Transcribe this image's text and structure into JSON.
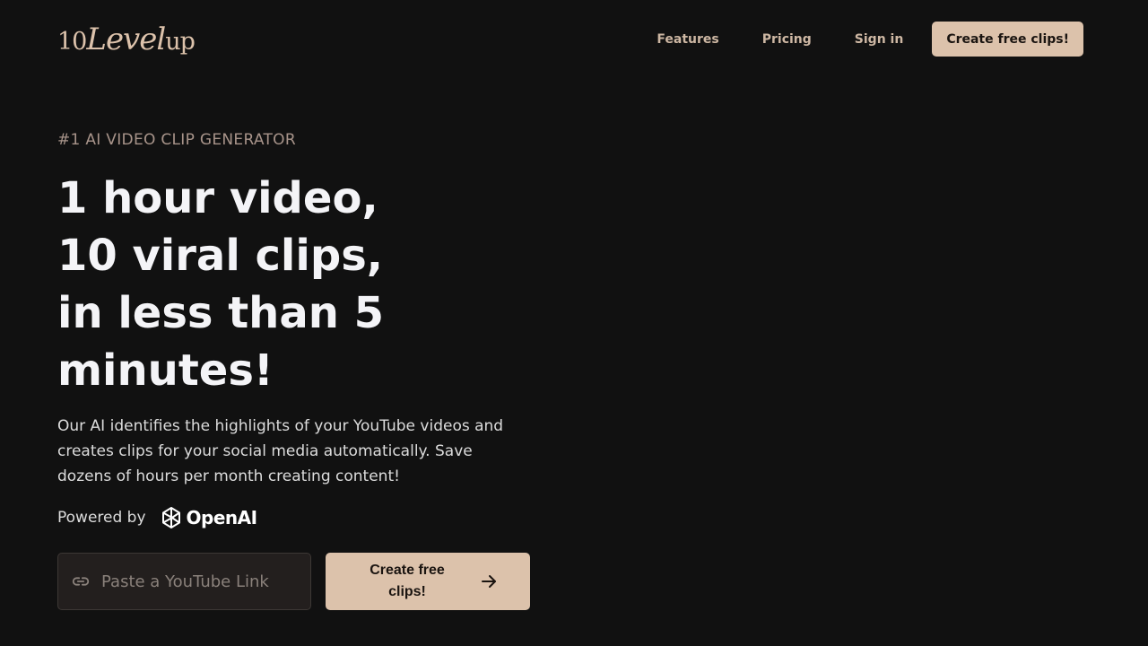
{
  "brand": {
    "logo_num": "10",
    "logo_level": "Level",
    "logo_up": "up"
  },
  "nav": {
    "items": [
      {
        "label": "Features"
      },
      {
        "label": "Pricing"
      },
      {
        "label": "Sign in"
      }
    ],
    "cta_label": "Create free clips!"
  },
  "hero": {
    "eyebrow": "#1 AI VIDEO CLIP GENERATOR",
    "headline_lines": [
      "1 hour video,",
      "10 viral clips,",
      "in less than 5",
      "minutes!"
    ],
    "description": "Our AI identifies the highlights of your YouTube videos and creates clips for your social media automatically. Save dozens of hours per month creating content!",
    "powered_by": "Powered by",
    "partner": "OpenAI"
  },
  "form": {
    "input_placeholder": "Paste a YouTube Link",
    "input_value": "",
    "submit_label": "Create free clips!",
    "link_icon": "link-icon",
    "arrow_icon": "arrow-right-icon"
  },
  "colors": {
    "background": "#111111",
    "accent": "#dcc2ab",
    "nav_text": "#cdb7a3",
    "eyebrow": "#a8948a"
  }
}
